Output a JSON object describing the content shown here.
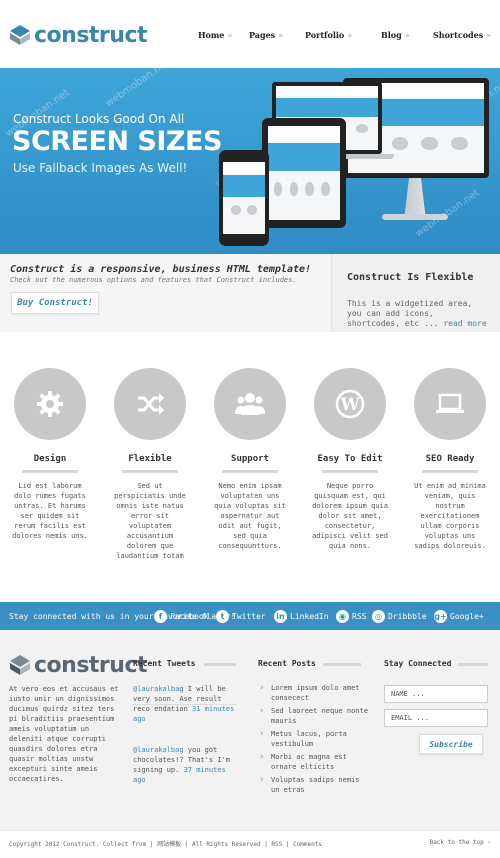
{
  "brand": {
    "name": "construct"
  },
  "nav": [
    {
      "label": "Home"
    },
    {
      "label": "Pages"
    },
    {
      "label": "Portfolio"
    },
    {
      "label": "Blog"
    },
    {
      "label": "Shortcodes"
    }
  ],
  "hero": {
    "line1": "Construct Looks Good On All",
    "line2": "SCREEN SIZES",
    "line3": "Use Fallback Images As Well!",
    "watermark": "webmoban.net"
  },
  "intro": {
    "tagline": "Construct is a responsive, business HTML template!",
    "sub": "Check out the numerous options and features that Construct includes.",
    "button": "Buy Construct!"
  },
  "widget": {
    "title": "Construct Is Flexible",
    "body": "This is a widgetized area, you can add icons, shortcodes, etc ... ",
    "more": "read more »"
  },
  "features": [
    {
      "icon": "gear-icon",
      "title": "Design",
      "text": "Lid est laborum dolo rumes fugats untras. Et harums ser quidem sit rerum facilis est dolores nemis uns."
    },
    {
      "icon": "shuffle-icon",
      "title": "Flexible",
      "text": "Sed ut perspiciatis unde omnis iste natus error sit voluptatem accusantium dolorem que laudantium totam"
    },
    {
      "icon": "users-icon",
      "title": "Support",
      "text": "Nemo enim ipsam voluptaten uns quia voluptas sit aspernatur aut odit aut fugit, sed quia consequuntturs."
    },
    {
      "icon": "wordpress-icon",
      "title": "Easy To Edit",
      "text": "Neque porro quisquam est, qui dolorem ipsum quia dolor sit amet, consectetur, adipisci velit sed quia nons."
    },
    {
      "icon": "laptop-icon",
      "title": "SEO Ready",
      "text": "Ut enim ad minima veniam, quis nostrum exercitationem ullam corporis voluptas uns sadips doloreuis."
    }
  ],
  "social": {
    "label": "Stay connected with us in your favorite flavor!",
    "links": [
      {
        "icon": "facebook-icon",
        "glyph": "f",
        "label": "Facebook"
      },
      {
        "icon": "twitter-icon",
        "glyph": "t",
        "label": "Twitter"
      },
      {
        "icon": "linkedin-icon",
        "glyph": "in",
        "label": "LinkedIn"
      },
      {
        "icon": "rss-icon",
        "glyph": "◉",
        "label": "RSS"
      },
      {
        "icon": "dribbble-icon",
        "glyph": "◎",
        "label": "Dribbble"
      },
      {
        "icon": "googleplus-icon",
        "glyph": "g+",
        "label": "Google+"
      }
    ]
  },
  "footer": {
    "about": "At vero eos et accusaus et iusto unir un dignissimos ducimus quirdz sitez ters pi blraditiis praesentium ameis voluptatum un deleniti atque corrupti quasdirs dolores etra quasir moltias unstw excepturi sinte ameis occaecatires.",
    "tweets_title": "Recent Tweets",
    "tweets": [
      {
        "user": "@laurakalbag",
        "text": " I will be very soon. Ase result reco endation ",
        "time": "31 minutes ago"
      },
      {
        "user": "@laurakalbag",
        "text": " you got chocolates!? That's I'm signing up. ",
        "time": "37 minutes ago"
      }
    ],
    "posts_title": "Recent Posts",
    "posts": [
      "Lorem ipsum dolo amet consecect",
      "Sed laoreet neque nonte mauris",
      "Metus lacus, porta vestibulum",
      "Morbi ac magna est ornare elticits",
      "Voluptas sadips nemis un etras"
    ],
    "connect_title": "Stay Connected",
    "name_placeholder": "NAME ...",
    "email_placeholder": "EMAIL ...",
    "subscribe": "Subscribe"
  },
  "bottom": {
    "copyright": "Copyright 2012 Construct. Collect from  | 网站模板 | All Rights Reserved | RSS | Comments",
    "to_top": "Back to the top ›"
  },
  "colors": {
    "accent": "#3a87ad",
    "hero": "#3fa5d8",
    "social_bar": "#3a8fc3",
    "icon_circle": "#c8c8c8"
  }
}
